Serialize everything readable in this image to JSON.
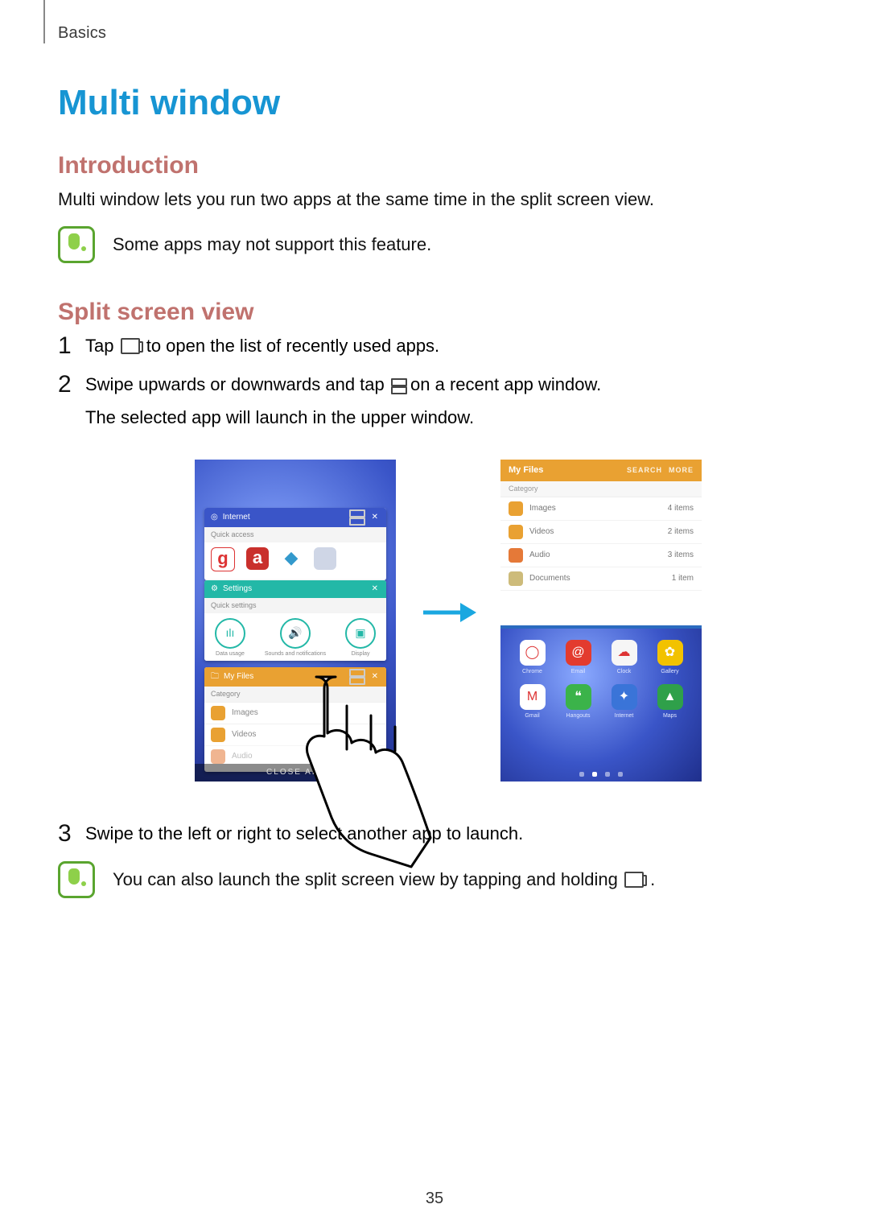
{
  "section_header": "Basics",
  "page_title": "Multi window",
  "intro": {
    "heading": "Introduction",
    "text": "Multi window lets you run two apps at the same time in the split screen view.",
    "note": "Some apps may not support this feature."
  },
  "split": {
    "heading": "Split screen view",
    "steps": {
      "s1_a": "Tap ",
      "s1_b": " to open the list of recently used apps.",
      "s2_a": "Swipe upwards or downwards and tap ",
      "s2_b": " on a recent app window.",
      "s2_c": "The selected app will launch in the upper window.",
      "s3": "Swipe to the left or right to select another app to launch."
    },
    "note2_a": "You can also launch the split screen view by tapping and holding ",
    "note2_b": "."
  },
  "figure": {
    "left": {
      "internet": {
        "title": "Internet",
        "sub": "Quick access"
      },
      "settings": {
        "title": "Settings",
        "sub": "Quick settings",
        "items": [
          "Data usage",
          "Sounds and notifications",
          "Display"
        ]
      },
      "files": {
        "title": "My Files",
        "sub": "Category",
        "rows": [
          "Images",
          "Videos",
          "Audio"
        ]
      },
      "close_all": "CLOSE ALL"
    },
    "right": {
      "title": "My Files",
      "links": [
        "SEARCH",
        "MORE"
      ],
      "category_label": "Category",
      "rows": [
        {
          "label": "Images",
          "meta": "4 items",
          "color": "#e9a132"
        },
        {
          "label": "Videos",
          "meta": "2 items",
          "color": "#e9a132"
        },
        {
          "label": "Audio",
          "meta": "3 items",
          "color": "#e57938"
        },
        {
          "label": "Documents",
          "meta": "1 item",
          "color": "#cdbb7a"
        }
      ],
      "apps": [
        {
          "label": "Chrome",
          "color": "#ffffff",
          "glyph": "◯"
        },
        {
          "label": "Email",
          "color": "#e33b2e",
          "glyph": "@"
        },
        {
          "label": "Clock",
          "color": "#f6f6f6",
          "glyph": "☁"
        },
        {
          "label": "Gallery",
          "color": "#f2c200",
          "glyph": "✿"
        },
        {
          "label": "Gmail",
          "color": "#ffffff",
          "glyph": "M"
        },
        {
          "label": "Hangouts",
          "color": "#3bb34a",
          "glyph": "❝"
        },
        {
          "label": "Internet",
          "color": "#3a74d8",
          "glyph": "✦"
        },
        {
          "label": "Maps",
          "color": "#2fa04a",
          "glyph": "▲"
        }
      ]
    }
  },
  "page_number": "35"
}
